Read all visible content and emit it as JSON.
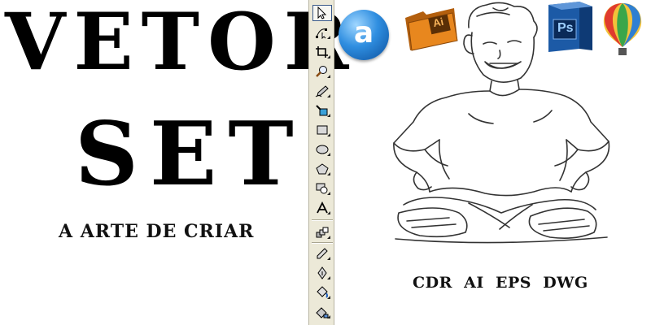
{
  "banner": {
    "title_line1": "VETOR",
    "title_line2": "SET",
    "tagline": "A ARTE DE CRIAR",
    "formats": "CDR  AI  EPS  DWG"
  },
  "toolbar": {
    "tools": [
      {
        "name": "pick-tool",
        "icon": "arrow-cursor-icon",
        "selected": true
      },
      {
        "name": "shape-tool",
        "icon": "node-shape-icon",
        "selected": false
      },
      {
        "name": "crop-tool",
        "icon": "crop-icon",
        "selected": false
      },
      {
        "name": "zoom-tool",
        "icon": "magnifier-icon",
        "selected": false
      },
      {
        "name": "freehand-tool",
        "icon": "pen-icon",
        "selected": false
      },
      {
        "name": "smart-fill-tool",
        "icon": "smart-fill-icon",
        "selected": false
      },
      {
        "name": "rectangle-tool",
        "icon": "rectangle-icon",
        "selected": false
      },
      {
        "name": "ellipse-tool",
        "icon": "ellipse-icon",
        "selected": false
      },
      {
        "name": "polygon-tool",
        "icon": "polygon-icon",
        "selected": false
      },
      {
        "name": "basic-shapes-tool",
        "icon": "basic-shapes-icon",
        "selected": false
      },
      {
        "name": "text-tool",
        "icon": "text-a-icon",
        "selected": false
      },
      {
        "name": "interactive-blend-tool",
        "icon": "blend-icon",
        "selected": false
      },
      {
        "name": "eyedropper-tool",
        "icon": "eyedropper-icon",
        "selected": false
      },
      {
        "name": "outline-tool",
        "icon": "pen-nib-icon",
        "selected": false
      },
      {
        "name": "fill-tool",
        "icon": "paint-bucket-icon",
        "selected": false
      },
      {
        "name": "interactive-fill-tool",
        "icon": "interactive-fill-icon",
        "selected": false
      }
    ]
  },
  "apps": [
    {
      "name": "vector-app",
      "icon": "vector-a-icon",
      "glyph": "a"
    },
    {
      "name": "adobe-illustrator",
      "icon": "illustrator-folder-icon",
      "glyph": "Ai"
    },
    {
      "name": "adobe-photoshop",
      "icon": "photoshop-box-icon",
      "glyph": "Ps"
    },
    {
      "name": "coreldraw",
      "icon": "coreldraw-balloon-icon",
      "glyph": ""
    }
  ],
  "colors": {
    "toolbar_bg": "#ece9d8",
    "vector_blue": "#2f8ee0",
    "illustrator_orange": "#e8871e",
    "photoshop_blue": "#1c5aa6"
  }
}
